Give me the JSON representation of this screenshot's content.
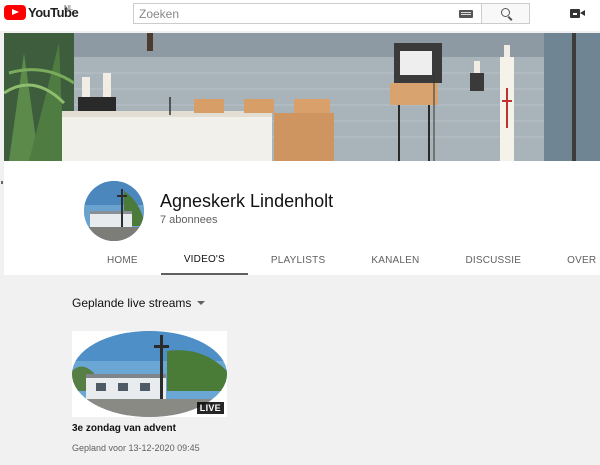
{
  "header": {
    "logo_text": "YouTube",
    "logo_region": "NL",
    "search_placeholder": "Zoeken"
  },
  "channel": {
    "name": "Agneskerk Lindenholt",
    "subscribers": "7 abonnees"
  },
  "tabs": [
    {
      "label": "HOME",
      "active": false
    },
    {
      "label": "VIDEO'S",
      "active": true
    },
    {
      "label": "PLAYLISTS",
      "active": false
    },
    {
      "label": "KANALEN",
      "active": false
    },
    {
      "label": "DISCUSSIE",
      "active": false
    },
    {
      "label": "OVER",
      "active": false
    }
  ],
  "section": {
    "title": "Geplande live streams"
  },
  "videos": [
    {
      "title": "3e zondag van advent",
      "meta": "Gepland voor 13-12-2020 09:45",
      "badge": "LIVE"
    }
  ],
  "colors": {
    "brand_red": "#ff0000",
    "background": "#f1f1f1",
    "text_primary": "#111111",
    "text_secondary": "#606060"
  }
}
